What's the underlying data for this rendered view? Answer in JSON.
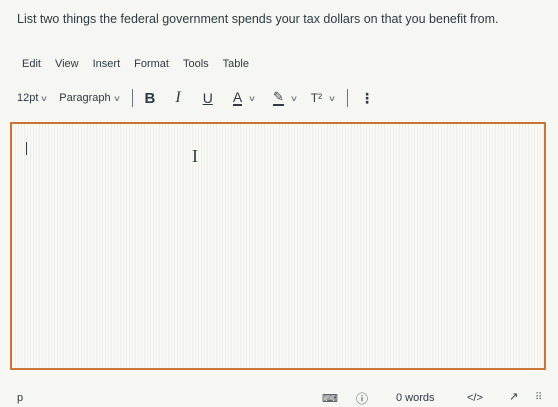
{
  "question": "List two things the federal government spends your tax dollars on that you benefit from.",
  "menubar": {
    "items": [
      "Edit",
      "View",
      "Insert",
      "Format",
      "Tools",
      "Table"
    ]
  },
  "toolbar": {
    "font_size": "12pt",
    "block_format": "Paragraph",
    "bold": "B",
    "italic": "I",
    "underline": "U",
    "text_color": "A",
    "superscript": "T²"
  },
  "statusbar": {
    "path": "p",
    "word_count": "0 words",
    "html_editor": "</>"
  },
  "colors": {
    "focus_border": "#c9763a",
    "text": "#2d3b45"
  }
}
